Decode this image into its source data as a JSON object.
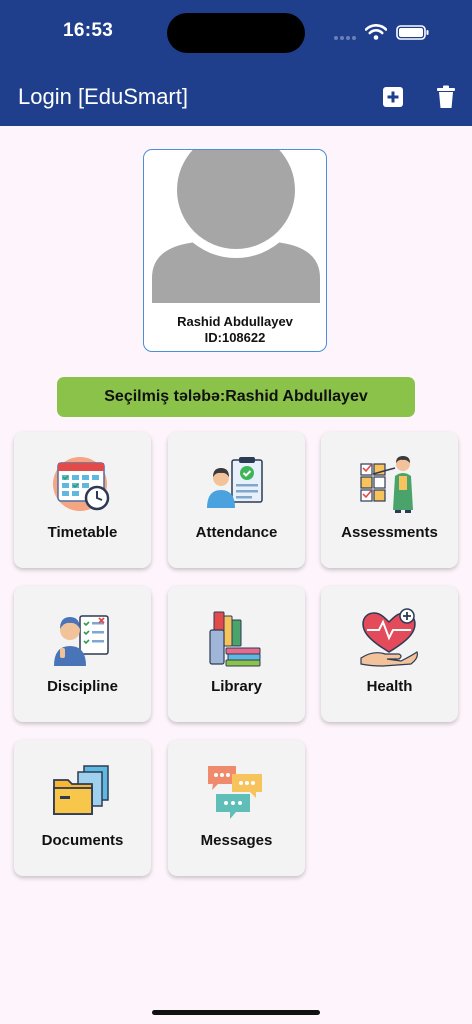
{
  "status_bar": {
    "time": "16:53"
  },
  "header": {
    "title": "Login [EduSmart]",
    "add_icon": "plus-square-icon",
    "delete_icon": "trash-icon"
  },
  "profile": {
    "name": "Rashid Abdullayev",
    "id": "ID:108622",
    "avatar_icon": "person-silhouette-icon"
  },
  "selected_student": "Seçilmiş tələbə:Rashid Abdullayev",
  "modules": [
    {
      "label": "Timetable",
      "icon": "calendar-clock-icon"
    },
    {
      "label": "Attendance",
      "icon": "attendance-clipboard-icon"
    },
    {
      "label": "Assessments",
      "icon": "assessment-board-icon"
    },
    {
      "label": "Discipline",
      "icon": "discipline-checklist-icon"
    },
    {
      "label": "Library",
      "icon": "books-icon"
    },
    {
      "label": "Health",
      "icon": "heart-hand-icon"
    },
    {
      "label": "Documents",
      "icon": "folder-documents-icon"
    },
    {
      "label": "Messages",
      "icon": "chat-bubbles-icon"
    }
  ],
  "colors": {
    "header": "#1f3f8c",
    "accent_green": "#8bc34a",
    "background": "#fdf5fb",
    "card_border": "#4b8fd6"
  }
}
